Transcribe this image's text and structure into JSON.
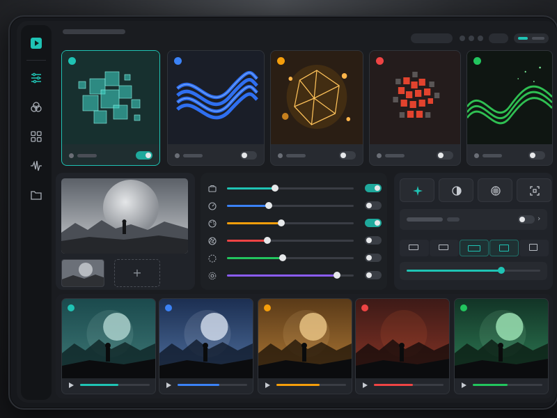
{
  "window": {
    "title": ""
  },
  "sidebar": {
    "items": [
      {
        "name": "play-logo",
        "icon": "play-icon"
      },
      {
        "name": "adjustments",
        "icon": "sliders-icon"
      },
      {
        "name": "color-blend",
        "icon": "circles-icon"
      },
      {
        "name": "grid",
        "icon": "grid-icon"
      },
      {
        "name": "audio",
        "icon": "waveform-icon"
      },
      {
        "name": "folder",
        "icon": "folder-icon"
      }
    ]
  },
  "presets": [
    {
      "color": "#1fc3b4",
      "label": "",
      "toggle_on": true,
      "active": true,
      "theme": "glass-cubes"
    },
    {
      "color": "#3b82f6",
      "label": "",
      "toggle_on": false,
      "active": false,
      "theme": "blue-waves"
    },
    {
      "color": "#f59e0b",
      "label": "",
      "toggle_on": false,
      "active": false,
      "theme": "gold-polyhedron"
    },
    {
      "color": "#ef4444",
      "label": "",
      "toggle_on": false,
      "active": false,
      "theme": "red-voxels"
    },
    {
      "color": "#22c55e",
      "label": "",
      "toggle_on": false,
      "active": false,
      "theme": "green-wave"
    }
  ],
  "preview": {
    "add_label": "+"
  },
  "adjustments": [
    {
      "icon": "camera-icon",
      "color": "#1fc3b4",
      "value": 0.38,
      "toggle_on": true
    },
    {
      "icon": "dial-icon",
      "color": "#3b82f6",
      "value": 0.33,
      "toggle_on": false
    },
    {
      "icon": "palette-icon",
      "color": "#f59e0b",
      "value": 0.43,
      "toggle_on": true
    },
    {
      "icon": "aperture-icon",
      "color": "#ef4444",
      "value": 0.32,
      "toggle_on": false
    },
    {
      "icon": "dashed-circle-icon",
      "color": "#22c55e",
      "value": 0.44,
      "toggle_on": false
    },
    {
      "icon": "gear-icon",
      "color": "#8b5cf6",
      "value": 0.87,
      "toggle_on": false
    }
  ],
  "effects": {
    "modes": [
      "sparkle-icon",
      "contrast-icon",
      "texture-icon",
      "focus-icon"
    ],
    "active_mode": 0,
    "dropdown_toggle_on": false,
    "ratios_active": [
      2,
      3
    ],
    "intensity": 0.71
  },
  "scenes": [
    {
      "color": "#1fc3b4",
      "progress": 0.55,
      "theme": "teal"
    },
    {
      "color": "#3b82f6",
      "progress": 0.6,
      "theme": "blue"
    },
    {
      "color": "#f59e0b",
      "progress": 0.62,
      "theme": "amber"
    },
    {
      "color": "#ef4444",
      "progress": 0.56,
      "theme": "red"
    },
    {
      "color": "#22c55e",
      "progress": 0.5,
      "theme": "green"
    }
  ]
}
